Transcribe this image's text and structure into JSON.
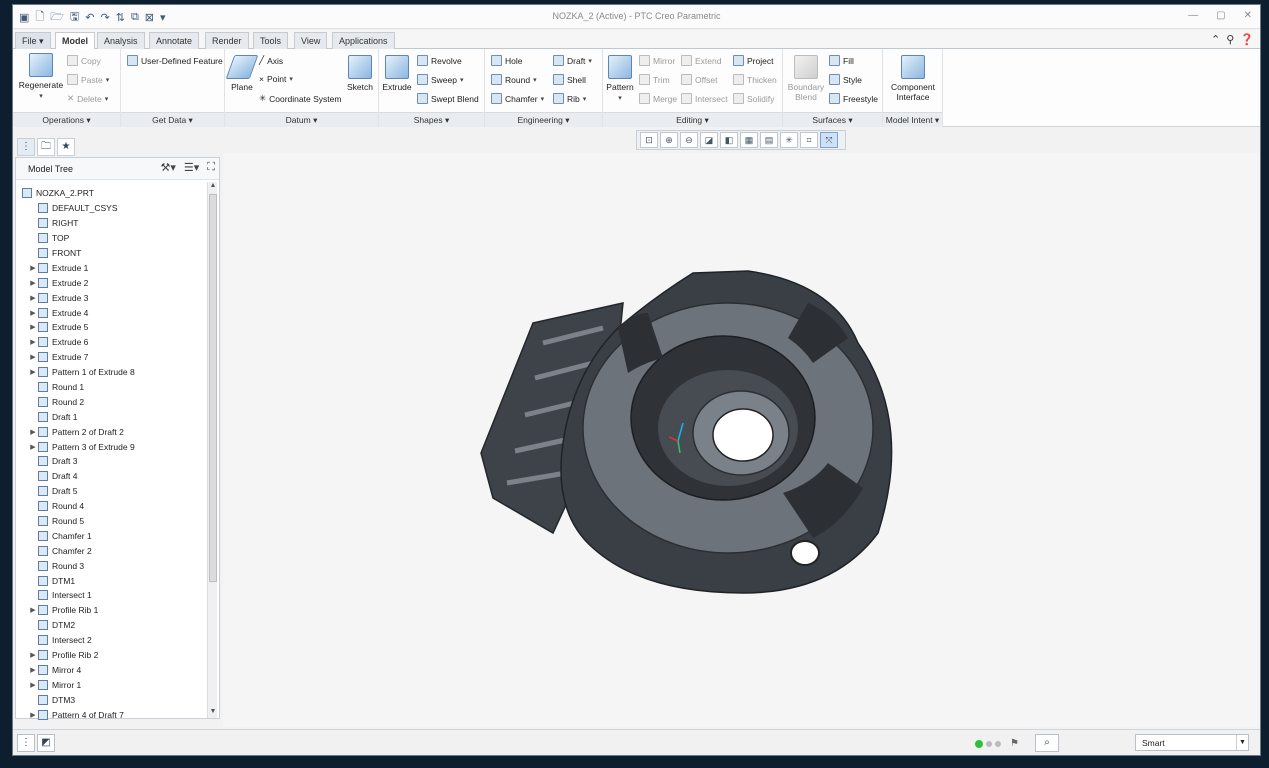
{
  "window": {
    "title": "NOZKA_2 (Active) - PTC Creo Parametric"
  },
  "tabs": [
    {
      "label": "File"
    },
    {
      "label": "Model"
    },
    {
      "label": "Analysis"
    },
    {
      "label": "Annotate"
    },
    {
      "label": "Render"
    },
    {
      "label": "Tools"
    },
    {
      "label": "View"
    },
    {
      "label": "Applications"
    }
  ],
  "ribbon": {
    "operations": {
      "label": "Operations",
      "regenerate": "Regenerate",
      "copy": "Copy",
      "paste": "Paste",
      "delete": "Delete"
    },
    "getdata": {
      "label": "Get Data",
      "udf": "User-Defined Feature"
    },
    "datum": {
      "label": "Datum",
      "plane": "Plane",
      "axis": "Axis",
      "point": "Point",
      "csys": "Coordinate System",
      "sketch": "Sketch"
    },
    "shapes": {
      "label": "Shapes",
      "extrude": "Extrude",
      "revolve": "Revolve",
      "sweep": "Sweep",
      "swept_blend": "Swept Blend"
    },
    "engineering": {
      "label": "Engineering",
      "hole": "Hole",
      "round": "Round",
      "chamfer": "Chamfer",
      "draft": "Draft",
      "shell": "Shell",
      "rib": "Rib"
    },
    "editing": {
      "label": "Editing",
      "pattern": "Pattern",
      "mirror": "Mirror",
      "trim": "Trim",
      "merge": "Merge",
      "extend": "Extend",
      "offset": "Offset",
      "intersect": "Intersect",
      "project": "Project",
      "thicken": "Thicken",
      "solidify": "Solidify"
    },
    "surfaces": {
      "label": "Surfaces",
      "boundary_blend": "Boundary Blend",
      "fill": "Fill",
      "style": "Style",
      "freestyle": "Freestyle"
    },
    "modelintent": {
      "label": "Model Intent",
      "component_interface": "Component Interface"
    }
  },
  "tree": {
    "title": "Model Tree",
    "items": [
      {
        "label": "NOZKA_2.PRT",
        "expandable": false
      },
      {
        "label": "DEFAULT_CSYS",
        "expandable": false
      },
      {
        "label": "RIGHT",
        "expandable": false
      },
      {
        "label": "TOP",
        "expandable": false
      },
      {
        "label": "FRONT",
        "expandable": false
      },
      {
        "label": "Extrude 1",
        "expandable": true
      },
      {
        "label": "Extrude 2",
        "expandable": true
      },
      {
        "label": "Extrude 3",
        "expandable": true
      },
      {
        "label": "Extrude 4",
        "expandable": true
      },
      {
        "label": "Extrude 5",
        "expandable": true
      },
      {
        "label": "Extrude 6",
        "expandable": true
      },
      {
        "label": "Extrude 7",
        "expandable": true
      },
      {
        "label": "Pattern 1 of Extrude 8",
        "expandable": true
      },
      {
        "label": "Round 1",
        "expandable": false
      },
      {
        "label": "Round 2",
        "expandable": false
      },
      {
        "label": "Draft 1",
        "expandable": false
      },
      {
        "label": "Pattern 2 of Draft 2",
        "expandable": true
      },
      {
        "label": "Pattern 3 of Extrude 9",
        "expandable": true
      },
      {
        "label": "Draft 3",
        "expandable": false
      },
      {
        "label": "Draft 4",
        "expandable": false
      },
      {
        "label": "Draft 5",
        "expandable": false
      },
      {
        "label": "Round 4",
        "expandable": false
      },
      {
        "label": "Round 5",
        "expandable": false
      },
      {
        "label": "Chamfer 1",
        "expandable": false
      },
      {
        "label": "Chamfer 2",
        "expandable": false
      },
      {
        "label": "Round 3",
        "expandable": false
      },
      {
        "label": "DTM1",
        "expandable": false
      },
      {
        "label": "Intersect 1",
        "expandable": false
      },
      {
        "label": "Profile Rib 1",
        "expandable": true
      },
      {
        "label": "DTM2",
        "expandable": false
      },
      {
        "label": "Intersect 2",
        "expandable": false
      },
      {
        "label": "Profile Rib 2",
        "expandable": true
      },
      {
        "label": "Mirror 4",
        "expandable": true
      },
      {
        "label": "Mirror 1",
        "expandable": true
      },
      {
        "label": "DTM3",
        "expandable": false
      },
      {
        "label": "Pattern 4 of Draft 7",
        "expandable": true
      }
    ]
  },
  "status": {
    "filter": "Smart"
  },
  "colors": {
    "model_fill": "#4a4f55",
    "model_top": "#6b7178",
    "viewport_bg": "#f5f5f5",
    "accent": "#3b78c4"
  }
}
